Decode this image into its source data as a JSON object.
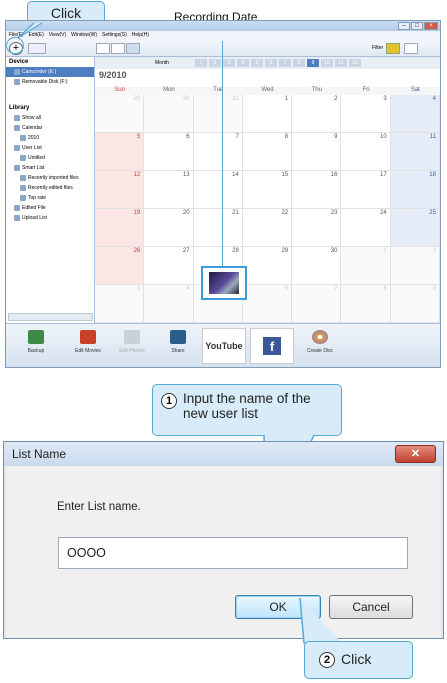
{
  "annotations": {
    "click_top": "Click",
    "recording_date": "Recording Date",
    "step1_number": "1",
    "step1_text": "Input the name of the new user list",
    "step2_number": "2",
    "step2_text": "Click"
  },
  "app": {
    "menu": [
      "File(F)",
      "Edit(E)",
      "View(V)",
      "Window(W)",
      "Settings(S)",
      "Help(H)"
    ],
    "filter_label": "Filter",
    "month_label": "Month",
    "month_numbers": [
      "1",
      "2",
      "3",
      "4",
      "5",
      "6",
      "7",
      "8",
      "9",
      "10",
      "11",
      "12"
    ],
    "current_month_index": 8,
    "calendar_title": "9/2010",
    "day_names": [
      "Sun",
      "Mon",
      "Tue",
      "Wed",
      "Thu",
      "Fri",
      "Sat"
    ],
    "device_header": "Device",
    "devices": [
      "Camcorder (E:)",
      "Removable Disk (F:)"
    ],
    "library_header": "Library",
    "library_items": [
      "Show all",
      "Calendar",
      "2010",
      "User List",
      "Untitled",
      "Smart List",
      "Recently imported files",
      "Recently edited files",
      "Top rate",
      "Edited File",
      "Upload List"
    ],
    "bottom_buttons": [
      "Backup",
      "Edit Movies",
      "Edit Photos",
      "Share",
      "YouTube",
      "f",
      "Create Disc"
    ],
    "calendar_rows": [
      [
        "29",
        "30",
        "31",
        "1",
        "2",
        "3",
        "4"
      ],
      [
        "5",
        "6",
        "7",
        "8",
        "9",
        "10",
        "11"
      ],
      [
        "12",
        "13",
        "14",
        "15",
        "16",
        "17",
        "18"
      ],
      [
        "19",
        "20",
        "21",
        "22",
        "23",
        "24",
        "25"
      ],
      [
        "26",
        "27",
        "28",
        "29",
        "30",
        "1",
        "2"
      ],
      [
        "3",
        "4",
        "5",
        "6",
        "7",
        "8",
        "9"
      ]
    ]
  },
  "dialog": {
    "title": "List Name",
    "close_glyph": "✕",
    "prompt": "Enter List name.",
    "input_value": "OOOO",
    "ok_label": "OK",
    "cancel_label": "Cancel"
  },
  "colors": {
    "accent": "#56a9d8",
    "callout_fill": "#d7ecf8"
  }
}
